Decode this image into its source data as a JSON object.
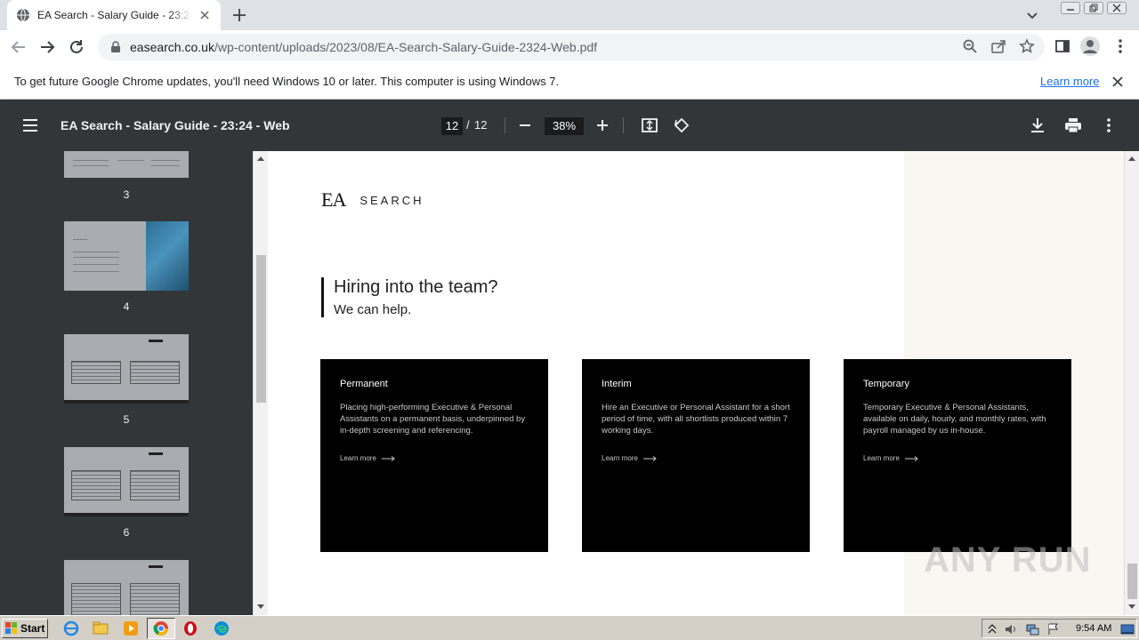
{
  "browser": {
    "tab_title": "EA Search - Salary Guide - 23:24 - Web",
    "url_host": "easearch.co.uk",
    "url_path": "/wp-content/uploads/2023/08/EA-Search-Salary-Guide-2324-Web.pdf"
  },
  "infobar": {
    "message": "To get future Google Chrome updates, you'll need Windows 10 or later. This computer is using Windows 7.",
    "link": "Learn more"
  },
  "pdf_toolbar": {
    "title": "EA Search - Salary Guide - 23:24 - Web",
    "current_page": "12",
    "separator": "/",
    "total_pages": "12",
    "zoom": "38%"
  },
  "sidebar": {
    "thumbnails": [
      {
        "label": "3"
      },
      {
        "label": "4"
      },
      {
        "label": "5"
      },
      {
        "label": "6"
      }
    ]
  },
  "page": {
    "logo_mark": "EA",
    "logo_text": "SEARCH",
    "heading": "Hiring into the team?",
    "subheading": "We can help.",
    "cards": [
      {
        "title": "Permanent",
        "desc": "Placing high-performing Executive & Personal Assistants on a permanent basis, underpinned by in-depth screening and referencing.",
        "link": "Learn more"
      },
      {
        "title": "Interim",
        "desc": "Hire an Executive or Personal Assistant for a short period of time, with all shortlists produced within 7 working days.",
        "link": "Learn more"
      },
      {
        "title": "Temporary",
        "desc": "Temporary Executive & Personal Assistants, available on daily, hourly, and monthly rates, with payroll managed by us in-house.",
        "link": "Learn more"
      }
    ]
  },
  "watermark": "ANY RUN",
  "taskbar": {
    "start_label": "Start",
    "clock": "9:54 AM"
  },
  "colors": {
    "pdf_toolbar_bg": "#323639",
    "card_bg": "#000000",
    "link_blue": "#1a73e8",
    "taskbar_bg": "#d4d0c8"
  }
}
